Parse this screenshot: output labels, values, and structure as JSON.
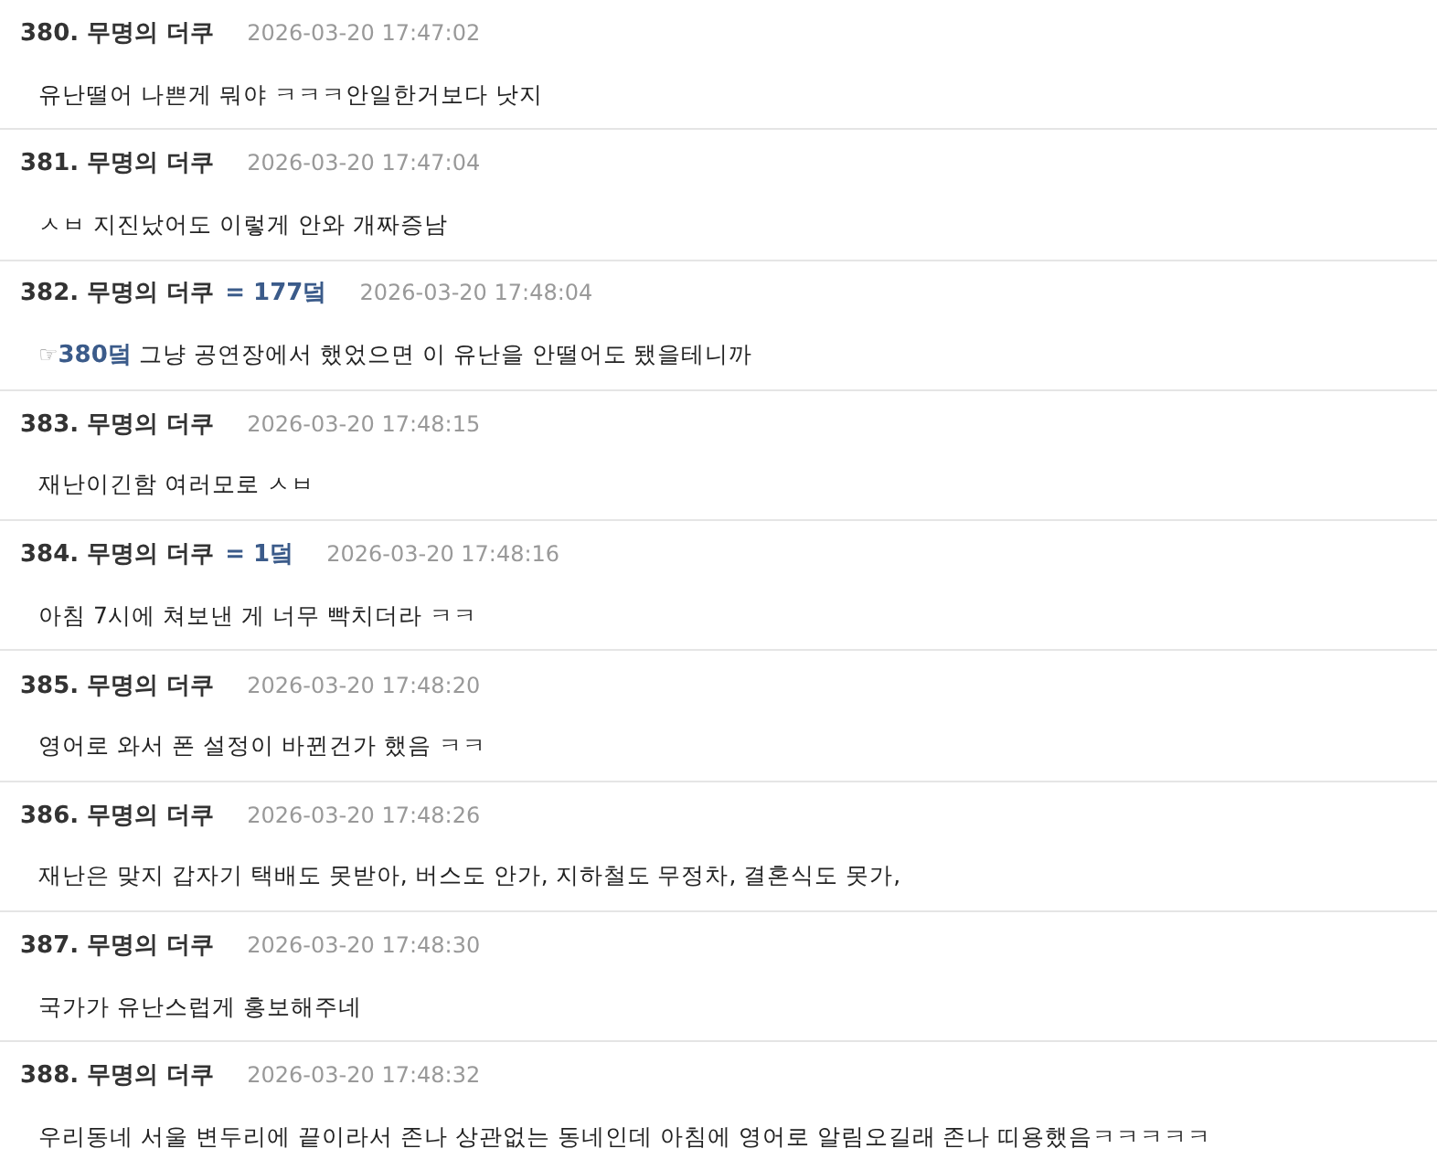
{
  "comments": [
    {
      "number": "380.",
      "author": "무명의 더쿠",
      "time": "2026-03-20 17:47:02",
      "body": "유난떨어 나쁜게 뭐야 ㅋㅋㅋ안일한거보다 낫지"
    },
    {
      "number": "381.",
      "author": "무명의 더쿠",
      "time": "2026-03-20 17:47:04",
      "body": "ㅅㅂ 지진났어도 이렇게 안와 개짜증남"
    },
    {
      "number": "382.",
      "author": "무명의 더쿠",
      "badge": "= 177덬",
      "time": "2026-03-20 17:48:04",
      "reply_mark": "☞",
      "reply_ref": "380덬",
      "body": "그냥 공연장에서 했었으면 이 유난을 안떨어도 됐을테니까"
    },
    {
      "number": "383.",
      "author": "무명의 더쿠",
      "time": "2026-03-20 17:48:15",
      "body": "재난이긴함 여러모로 ㅅㅂ"
    },
    {
      "number": "384.",
      "author": "무명의 더쿠",
      "badge": "= 1덬",
      "time": "2026-03-20 17:48:16",
      "body": "아침 7시에 쳐보낸 게 너무 빡치더라 ㅋㅋ"
    },
    {
      "number": "385.",
      "author": "무명의 더쿠",
      "time": "2026-03-20 17:48:20",
      "body": "영어로 와서 폰 설정이 바뀐건가 했음 ㅋㅋ"
    },
    {
      "number": "386.",
      "author": "무명의 더쿠",
      "time": "2026-03-20 17:48:26",
      "body": "재난은 맞지 갑자기 택배도 못받아, 버스도 안가, 지하철도 무정차, 결혼식도 못가,"
    },
    {
      "number": "387.",
      "author": "무명의 더쿠",
      "time": "2026-03-20 17:48:30",
      "body": "국가가 유난스럽게 홍보해주네"
    },
    {
      "number": "388.",
      "author": "무명의 더쿠",
      "time": "2026-03-20 17:48:32",
      "body": "우리동네 서울 변두리에 끝이라서 존나 상관없는 동네인데 아침에 영어로 알림오길래 존나 띠용했음ㅋㅋㅋㅋㅋ"
    }
  ]
}
